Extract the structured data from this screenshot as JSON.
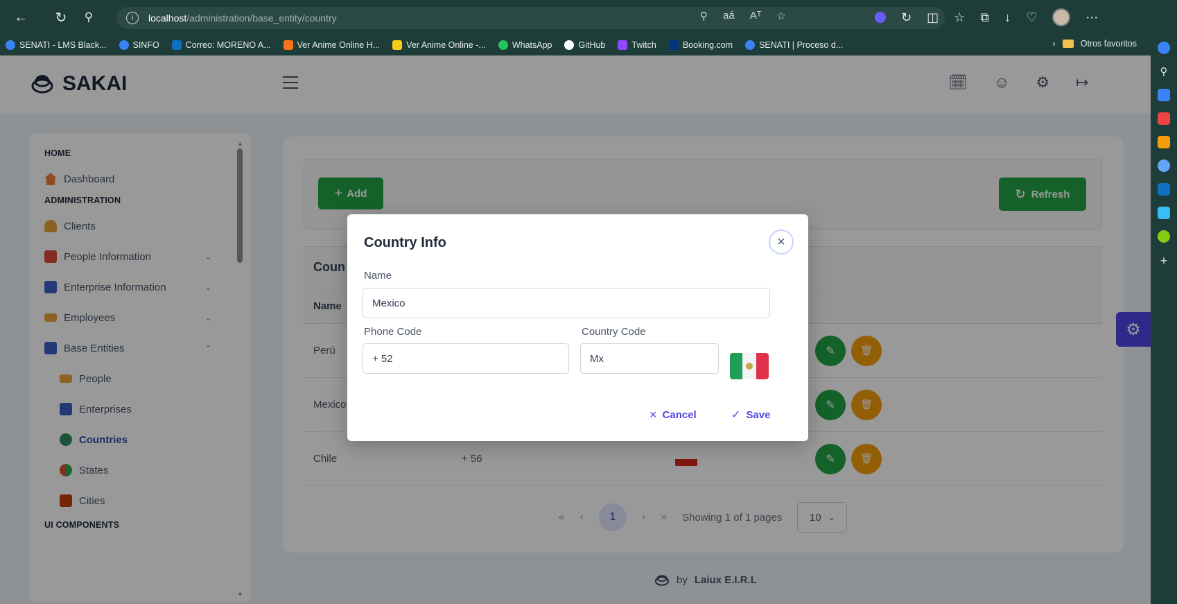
{
  "browser": {
    "url_host": "localhost",
    "url_path": "/administration/base_entity/country",
    "bookmarks": [
      {
        "label": "SENATI - LMS Black...",
        "color": "#3b82f6"
      },
      {
        "label": "SINFO",
        "color": "#3b82f6"
      },
      {
        "label": "Correo: MORENO A...",
        "color": "#0e70c0"
      },
      {
        "label": "Ver Anime Online H...",
        "color": "#f97316"
      },
      {
        "label": "Ver Anime Online -...",
        "color": "#facc15"
      },
      {
        "label": "WhatsApp",
        "color": "#22c55e"
      },
      {
        "label": "GitHub",
        "color": "#ffffff"
      },
      {
        "label": "Twitch",
        "color": "#9146ff"
      },
      {
        "label": "Booking.com",
        "color": "#003580"
      },
      {
        "label": "SENATI | Proceso d...",
        "color": "#3b82f6"
      }
    ],
    "other_favorites": "Otros favoritos"
  },
  "app": {
    "logo_text": "SAKAI",
    "footer_text": "by",
    "footer_brand": "Laiux E.I.R.L"
  },
  "sidebar": {
    "sections": [
      {
        "title": "HOME"
      },
      {
        "title": "ADMINISTRATION"
      },
      {
        "title": "UI COMPONENTS"
      }
    ],
    "items": {
      "dashboard": "Dashboard",
      "clients": "Clients",
      "people_information": "People Information",
      "enterprise_information": "Enterprise Information",
      "employees": "Employees",
      "base_entities": "Base Entities",
      "people": "People",
      "enterprises": "Enterprises",
      "countries": "Countries",
      "states": "States",
      "cities": "Cities"
    }
  },
  "main": {
    "add_label": "Add",
    "refresh_label": "Refresh",
    "table_title": "Coun",
    "col_name": "Name",
    "rows": [
      {
        "name": "Perú",
        "phone": ""
      },
      {
        "name": "Mexico",
        "phone": ""
      },
      {
        "name": "Chile",
        "phone": "+ 56"
      }
    ],
    "paginator": {
      "current_page": "1",
      "report": "Showing 1 of 1 pages",
      "rows_per_page": "10"
    }
  },
  "dialog": {
    "title": "Country Info",
    "name_label": "Name",
    "name_value": "Mexico",
    "phone_label": "Phone Code",
    "phone_value": "+ 52",
    "country_code_label": "Country Code",
    "country_code_value": "Mx",
    "cancel_label": "Cancel",
    "save_label": "Save"
  },
  "colors": {
    "primary": "#4f46e5",
    "success": "#22a447",
    "warning": "#f59e0b",
    "browser_chrome": "#1e3d38"
  }
}
